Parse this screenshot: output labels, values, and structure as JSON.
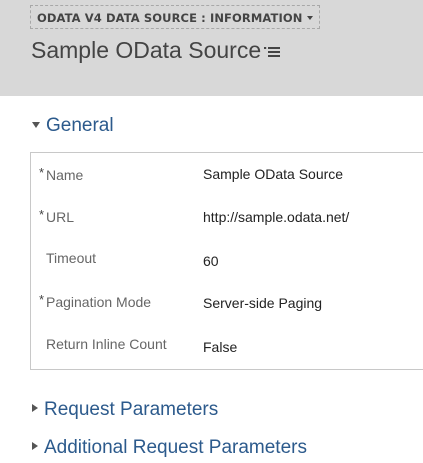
{
  "header": {
    "entity_selector": "ODATA V4 DATA SOURCE : INFORMATION",
    "record_title": "Sample OData Source"
  },
  "sections": {
    "general": "General",
    "request_parameters": "Request Parameters",
    "additional_request_parameters": "Additional Request Parameters"
  },
  "fields": [
    {
      "label": "Name",
      "required": "*",
      "value": "Sample OData Source"
    },
    {
      "label": "URL",
      "required": "*",
      "value": "http://sample.odata.net/"
    },
    {
      "label": "Timeout",
      "required": "",
      "value": "60"
    },
    {
      "label": "Pagination Mode",
      "required": "*",
      "value": "Server-side Paging"
    },
    {
      "label": "Return Inline Count",
      "required": "",
      "value": "False"
    }
  ],
  "icons": {
    "form_selector": "caret-down-icon",
    "record_menu": "list-menu-icon",
    "section_expanded": "triangle-down-icon",
    "section_collapsed": "triangle-right-icon"
  },
  "colors": {
    "header_background": "#d8d8d8",
    "section_title": "#2c5a8c",
    "form_border": "#c8c8c8"
  }
}
